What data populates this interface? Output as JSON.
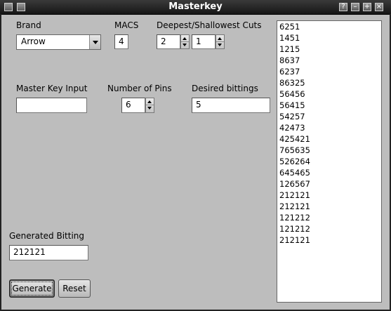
{
  "window": {
    "title": "Masterkey"
  },
  "brand": {
    "label": "Brand",
    "value": "Arrow"
  },
  "macs": {
    "label": "MACS",
    "value": "4"
  },
  "cuts": {
    "label": "Deepest/Shallowest Cuts",
    "deepest": "2",
    "shallowest": "1"
  },
  "master_key": {
    "label": "Master Key Input",
    "value": ""
  },
  "pins": {
    "label": "Number of Pins",
    "value": "6"
  },
  "desired": {
    "label": "Desired bittings",
    "value": "5"
  },
  "generated": {
    "label": "Generated Bitting",
    "value": "212121"
  },
  "buttons": {
    "generate": "Generate",
    "reset": "Reset"
  },
  "results": {
    "items": [
      "6251",
      "1451",
      "1215",
      "8637",
      "6237",
      "86325",
      "56456",
      "56415",
      "54257",
      "42473",
      "425421",
      "765635",
      "526264",
      "645465",
      "126567",
      "212121",
      "212121",
      "121212",
      "121212",
      "212121"
    ]
  }
}
